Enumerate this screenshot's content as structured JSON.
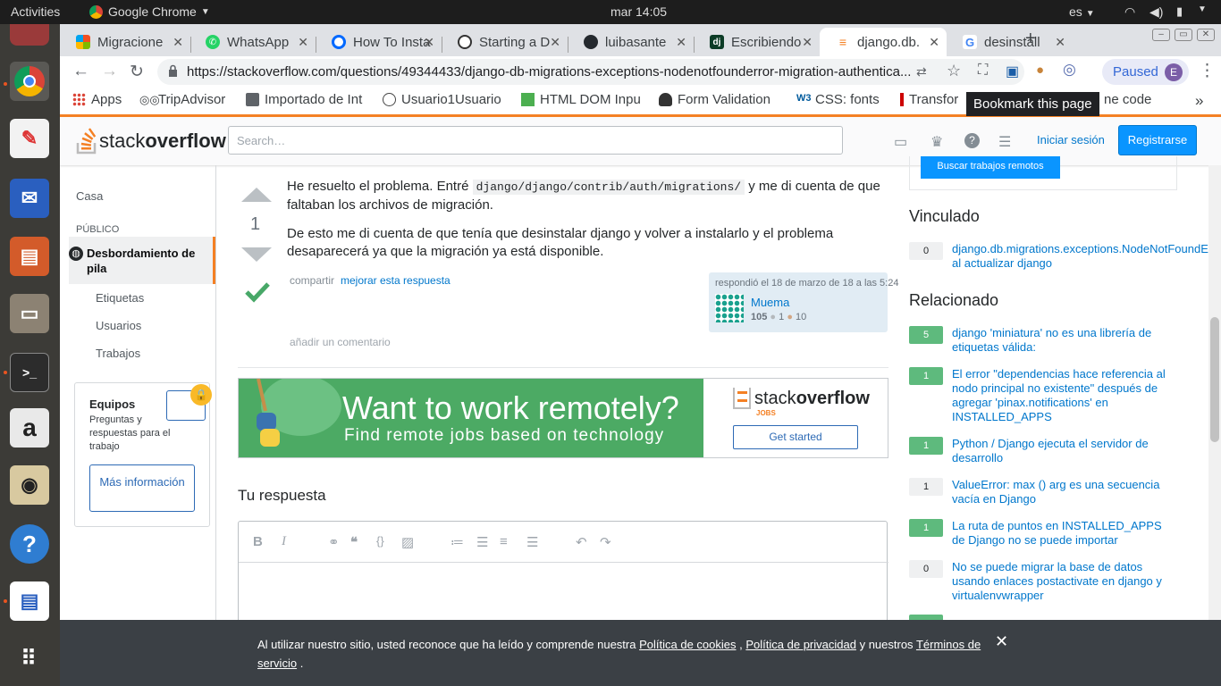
{
  "system": {
    "activities": "Activities",
    "app": "Google Chrome",
    "clock": "mar 14:05",
    "lang": "es"
  },
  "tabs": [
    {
      "title": "Migracione",
      "icon": "windows-icon"
    },
    {
      "title": "WhatsApp",
      "icon": "whatsapp-icon"
    },
    {
      "title": "How To Insta",
      "icon": "digitalocean-icon"
    },
    {
      "title": "Starting a D",
      "icon": "chrome-icon"
    },
    {
      "title": "luibasante",
      "icon": "github-icon"
    },
    {
      "title": "Escribiendo",
      "icon": "django-icon"
    },
    {
      "title": "django.db.",
      "icon": "stackoverflow-icon"
    },
    {
      "title": "desinstall",
      "icon": "google-icon"
    }
  ],
  "toolbar": {
    "url": "https://stackoverflow.com/questions/49344433/django-db-migrations-exceptions-nodenotfounderror-migration-authentica...",
    "profile_label": "Paused",
    "profile_initial": "E",
    "tooltip": "Bookmark this page"
  },
  "bookmarks": [
    {
      "label": "Apps"
    },
    {
      "label": "TripAdvisor"
    },
    {
      "label": "Importado de Int"
    },
    {
      "label": "Usuario1Usuario"
    },
    {
      "label": "HTML DOM Inpu"
    },
    {
      "label": "Form Validation"
    },
    {
      "label": "CSS: fonts"
    },
    {
      "label": "Transfor"
    },
    {
      "label": "ne code"
    }
  ],
  "so": {
    "logo_a": "stack",
    "logo_b": "overflow",
    "search_placeholder": "Search…",
    "login": "Iniciar sesión",
    "signup": "Registrarse",
    "nav": {
      "home": "Casa",
      "public": "PÚBLICO",
      "stackoverflow": "Desbordamiento de pila",
      "tags": "Etiquetas",
      "users": "Usuarios",
      "jobs": "Trabajos"
    },
    "teams": {
      "title": "Equipos",
      "text": "Preguntas y respuestas para el trabajo",
      "button": "Más información"
    },
    "answer": {
      "votes": "1",
      "p1_a": "He resuelto el problema. Entré",
      "p1_code": "django/django/contrib/auth/migrations/",
      "p1_b": "y me di cuenta de que faltaban los archivos de migración.",
      "p2": "De esto me di cuenta de que tenía que desinstalar django y volver a instalarlo y el problema desaparecerá ya que la migración ya está disponible.",
      "share": "compartir",
      "improve": "mejorar esta respuesta",
      "answered": "respondió el 18 de marzo de 18 a las 5:24",
      "user": "Muema",
      "rep": "105",
      "silver": "1",
      "bronze": "10",
      "add_comment": "añadir un comentario"
    },
    "ad": {
      "line1": "Want to work remotely?",
      "line2": "Find remote jobs based on technology",
      "brand_a": "stack",
      "brand_b": "overflow",
      "brand_sub": "JOBS",
      "cta": "Get started"
    },
    "your_answer": "Tu respuesta",
    "remote_button": "Buscar trabajos remotos",
    "linked_title": "Vinculado",
    "linked": [
      {
        "count": "0",
        "title": "django.db.migrations.exceptions.NodeNotFoundError al actualizar django"
      }
    ],
    "related_title": "Relacionado",
    "related": [
      {
        "count": "5",
        "title": "django 'miniatura' no es una librería de etiquetas válida:",
        "accepted": true
      },
      {
        "count": "1",
        "title": "El error \"dependencias hace referencia al nodo principal no existente\" después de agregar 'pinax.notifications' en INSTALLED_APPS",
        "accepted": true
      },
      {
        "count": "1",
        "title": "Python / Django ejecuta el servidor de desarrollo",
        "accepted": true
      },
      {
        "count": "1",
        "title": "ValueError: max () arg es una secuencia vacía en Django",
        "accepted": false
      },
      {
        "count": "1",
        "title": "La ruta de puntos en INSTALLED_APPS de Django no se puede importar",
        "accepted": true
      },
      {
        "count": "0",
        "title": "No se puede migrar la base de datos usando enlaces postactivate en django y virtualenvwrapper",
        "accepted": false
      }
    ],
    "cookie": {
      "t1": "Al utilizar nuestro sitio, usted reconoce que ha leído y comprende nuestra",
      "l1": "Política de cookies",
      "t2": ",",
      "l2": "Política de privacidad",
      "t3": "y nuestros",
      "l3": "Términos de servicio",
      "t4": "."
    }
  },
  "colors": {
    "so_orange": "#f48024",
    "so_blue": "#0077cc",
    "accepted_green": "#5eba7d",
    "ad_green": "#45a163"
  }
}
